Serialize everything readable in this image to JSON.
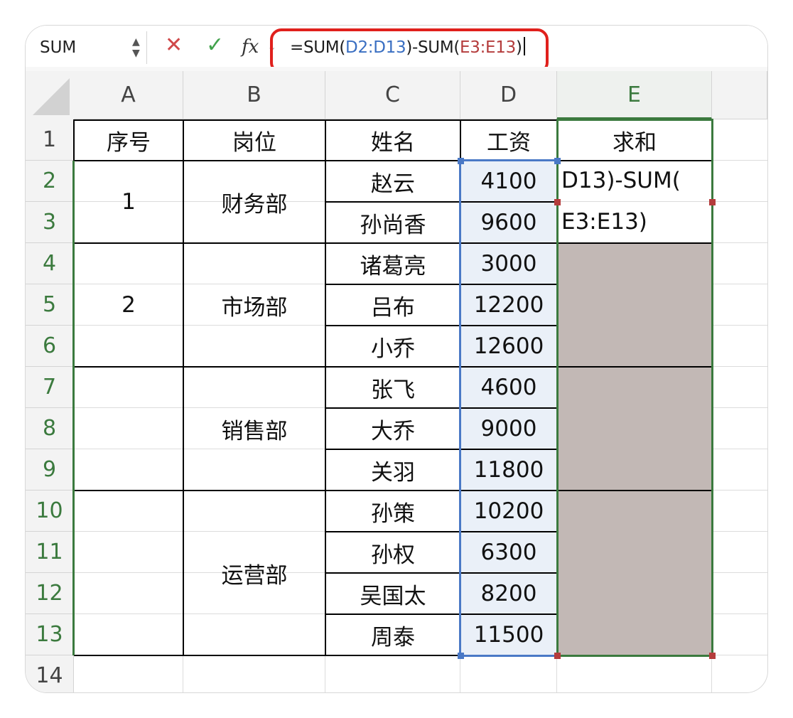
{
  "formula_bar": {
    "name_box": "SUM",
    "cancel_icon": "cross-icon",
    "enter_icon": "check-icon",
    "fx_label": "fx",
    "formula_prefix": "=SUM(",
    "formula_ref1": "D2:D13",
    "formula_mid": ")-SUM(",
    "formula_ref2": "E3:E13",
    "formula_suffix": ")"
  },
  "columns": [
    "A",
    "B",
    "C",
    "D",
    "E"
  ],
  "rows": [
    "1",
    "2",
    "3",
    "4",
    "5",
    "6",
    "7",
    "8",
    "9",
    "10",
    "11",
    "12",
    "13",
    "14"
  ],
  "headers": {
    "a": "序号",
    "b": "岗位",
    "c": "姓名",
    "d": "工资",
    "e": "求和"
  },
  "groups": [
    {
      "seq": "1",
      "dept": "财务部"
    },
    {
      "seq": "2",
      "dept": "市场部"
    },
    {
      "seq": "",
      "dept": "销售部"
    },
    {
      "seq": "",
      "dept": "运营部"
    }
  ],
  "names": [
    "赵云",
    "孙尚香",
    "诸葛亮",
    "吕布",
    "小乔",
    "张飞",
    "大乔",
    "关羽",
    "孙策",
    "孙权",
    "吴国太",
    "周泰"
  ],
  "salaries": [
    "4100",
    "9600",
    "3000",
    "12200",
    "12600",
    "4600",
    "9000",
    "11800",
    "10200",
    "6300",
    "8200",
    "11500"
  ],
  "edit_cell": {
    "line1": "D13)-SUM(",
    "line2": "E3:E13)"
  },
  "colors": {
    "accent_green": "#3b7a3e",
    "ref_blue": "#3a6fc2",
    "ref_red": "#b43c3c",
    "highlight_red": "#e0201c",
    "fill_gray": "#c2b8b5"
  }
}
